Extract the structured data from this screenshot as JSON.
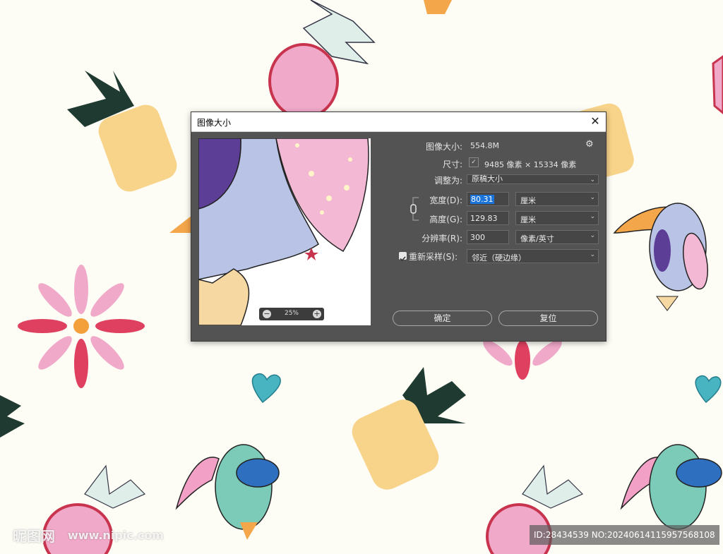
{
  "dialog": {
    "title": "图像大小",
    "close_glyph": "✕",
    "image_size_label": "图像大小:",
    "image_size_value": "554.8M",
    "dimensions_label": "尺寸:",
    "dimensions_value": "9485 像素  ×  15334 像素",
    "fit_to_label": "调整为:",
    "fit_to_value": "原稿大小",
    "width_label": "宽度(D):",
    "width_value": "80.31",
    "width_unit": "厘米",
    "height_label": "高度(G):",
    "height_value": "129.83",
    "height_unit": "厘米",
    "resolution_label": "分辨率(R):",
    "resolution_value": "300",
    "resolution_unit": "像素/英寸",
    "resample_label": "重新采样(S):",
    "resample_checked": true,
    "resample_value": "邻近（硬边缘）",
    "zoom_value": "25%",
    "ok_label": "确定",
    "reset_label": "复位"
  },
  "watermark": {
    "logo": "昵图网",
    "site": "www.nipic.com",
    "id_text": "ID:28434539 NO:20240614115957568108"
  },
  "icons": {
    "gear": "gear-icon",
    "link": "link-chain-icon",
    "dimensions": "chevron-down-icon",
    "zoom_out": "zoom-out-icon",
    "zoom_in": "zoom-in-icon"
  }
}
